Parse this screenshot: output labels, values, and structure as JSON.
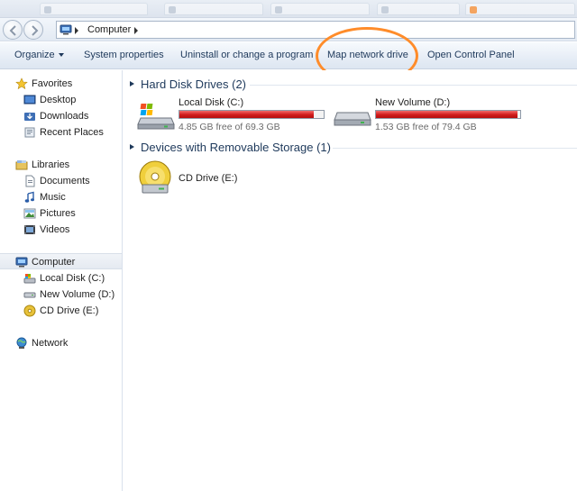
{
  "address": {
    "path": "Computer"
  },
  "toolbar": {
    "organize": "Organize",
    "system_properties": "System properties",
    "uninstall": "Uninstall or change a program",
    "map_network_drive": "Map network drive",
    "open_control_panel": "Open Control Panel"
  },
  "nav": {
    "favorites": "Favorites",
    "desktop": "Desktop",
    "downloads": "Downloads",
    "recent_places": "Recent Places",
    "libraries": "Libraries",
    "documents": "Documents",
    "music": "Music",
    "pictures": "Pictures",
    "videos": "Videos",
    "computer": "Computer",
    "local_disk": "Local Disk (C:)",
    "new_volume": "New Volume (D:)",
    "cd_drive": "CD Drive (E:)",
    "network": "Network"
  },
  "content": {
    "hard_disk_header": "Hard Disk Drives (2)",
    "removable_header": "Devices with Removable Storage (1)",
    "drives": [
      {
        "name": "Local Disk (C:)",
        "free_text": "4.85 GB free of 69.3 GB",
        "used_fraction": 0.93
      },
      {
        "name": "New Volume (D:)",
        "free_text": "1.53 GB free of 79.4 GB",
        "used_fraction": 0.98
      }
    ],
    "removable": [
      {
        "name": "CD Drive (E:)"
      }
    ]
  },
  "colors": {
    "accent_text": "#1e395b",
    "usage_bar": "#d01b1b",
    "highlight_ring": "#ff8c2a"
  }
}
